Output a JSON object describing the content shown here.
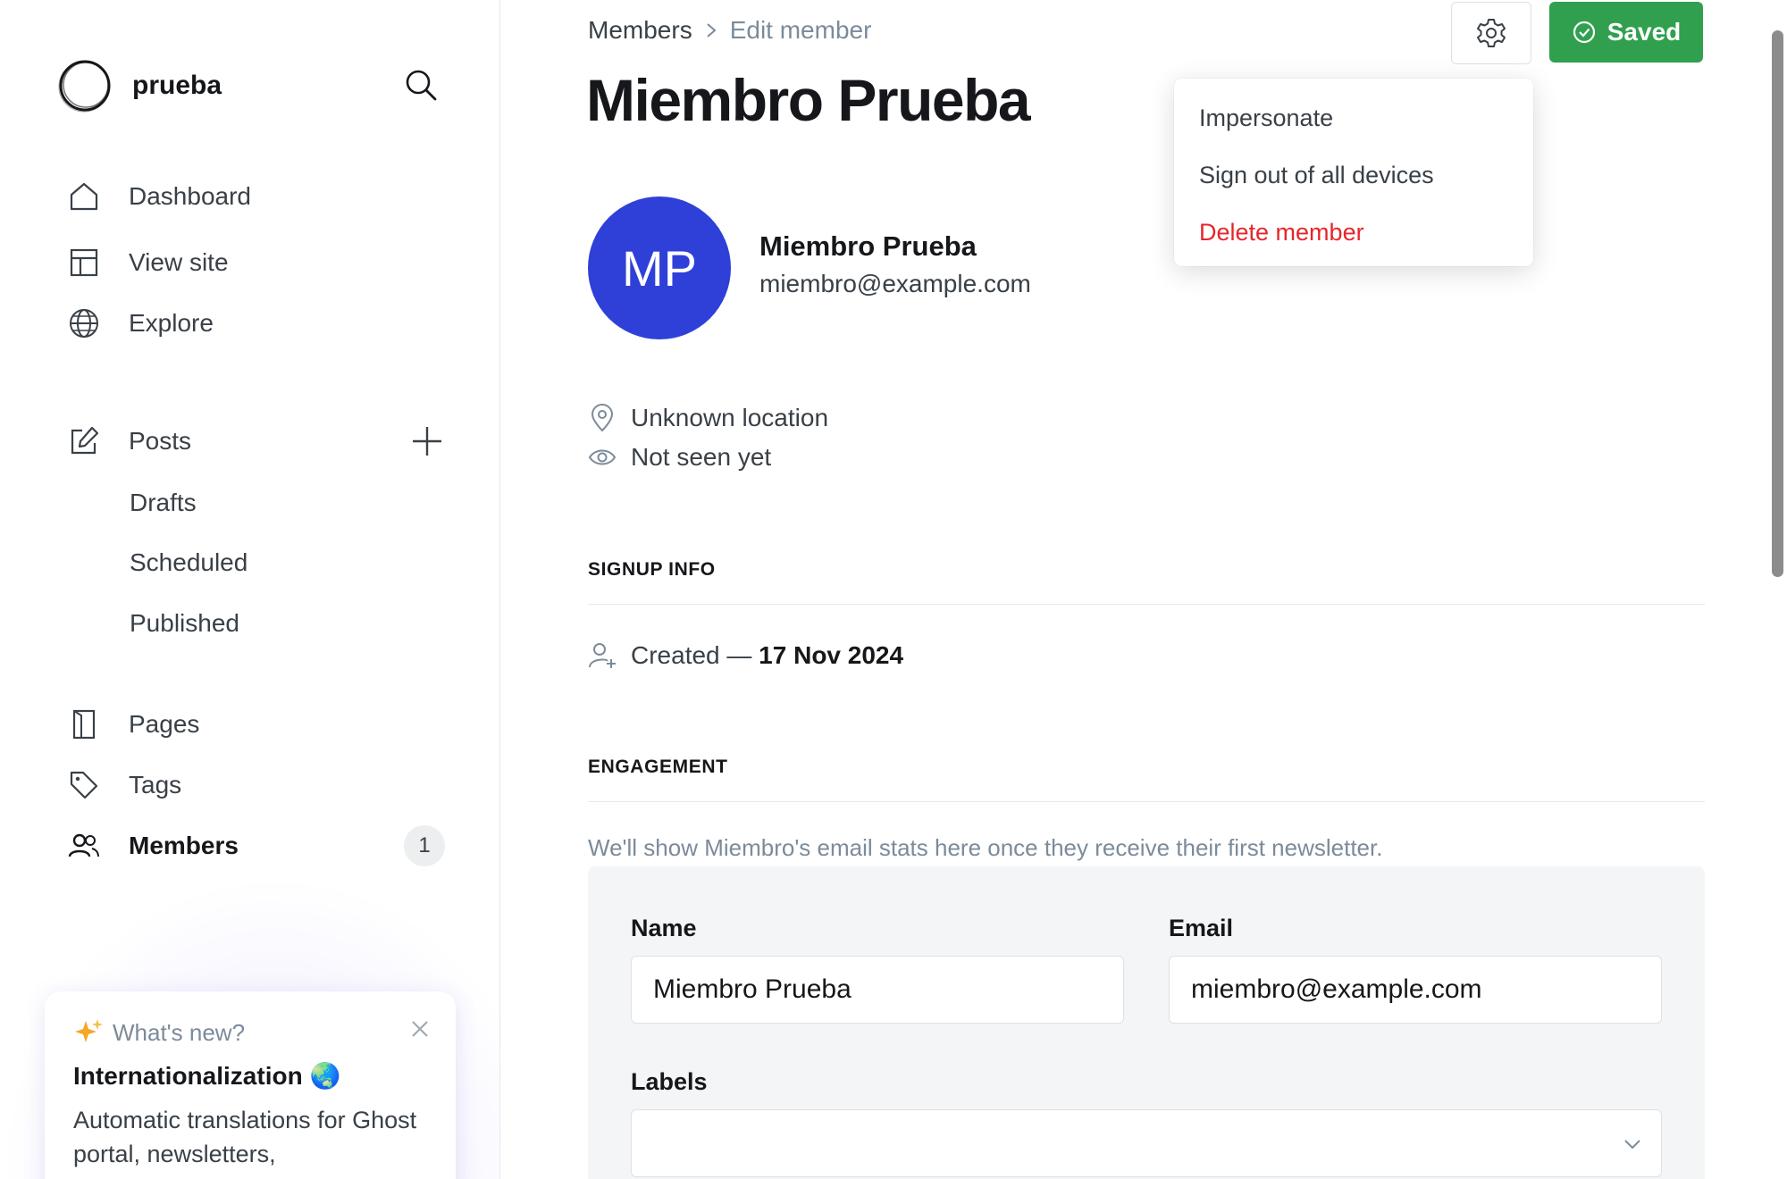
{
  "sidebar": {
    "brand": {
      "name": "prueba",
      "logo_icon": "circle-logo-icon"
    },
    "search_icon": "search-icon",
    "nav": [
      {
        "label": "Dashboard",
        "icon": "home-icon"
      },
      {
        "label": "View site",
        "icon": "layout-icon"
      },
      {
        "label": "Explore",
        "icon": "globe-icon"
      }
    ],
    "posts": {
      "label": "Posts",
      "icon": "edit-icon",
      "add_icon": "plus-icon",
      "sub_items": [
        "Drafts",
        "Scheduled",
        "Published"
      ]
    },
    "pages": {
      "label": "Pages",
      "icon": "page-icon"
    },
    "tags": {
      "label": "Tags",
      "icon": "tag-icon"
    },
    "members": {
      "label": "Members",
      "icon": "members-icon",
      "count": "1"
    },
    "whats_new": {
      "header": "What's new?",
      "icon": "sparkle-icon",
      "title": "Internationalization 🌏",
      "text": "Automatic translations for Ghost portal, newsletters,"
    }
  },
  "main": {
    "breadcrumb": {
      "parent": "Members",
      "current": "Edit member"
    },
    "title": "Miembro Prueba",
    "actions": {
      "settings_icon": "gear-icon",
      "saved_label": "Saved",
      "saved_icon": "check-circle-icon"
    },
    "menu": {
      "items": [
        {
          "label": "Impersonate",
          "danger": false
        },
        {
          "label": "Sign out of all devices",
          "danger": false
        },
        {
          "label": "Delete member",
          "danger": true
        }
      ]
    },
    "member": {
      "initials": "MP",
      "name": "Miembro Prueba",
      "email": "miembro@example.com",
      "avatar_color": "#2f40d8",
      "location": "Unknown location",
      "last_seen": "Not seen yet"
    },
    "signup": {
      "heading": "SIGNUP INFO",
      "created_prefix": "Created — ",
      "created_date": "17 Nov 2024"
    },
    "engagement": {
      "heading": "ENGAGEMENT",
      "note": "We'll show Miembro's email stats here once they receive their first newsletter."
    },
    "form": {
      "name_label": "Name",
      "name_value": "Miembro Prueba",
      "email_label": "Email",
      "email_value": "miembro@example.com",
      "labels_label": "Labels",
      "labels_value": ""
    }
  },
  "colors": {
    "accent_green": "#30a04f",
    "danger_red": "#e5262c",
    "muted_text": "#7c8b9a",
    "body_text": "#394047"
  }
}
